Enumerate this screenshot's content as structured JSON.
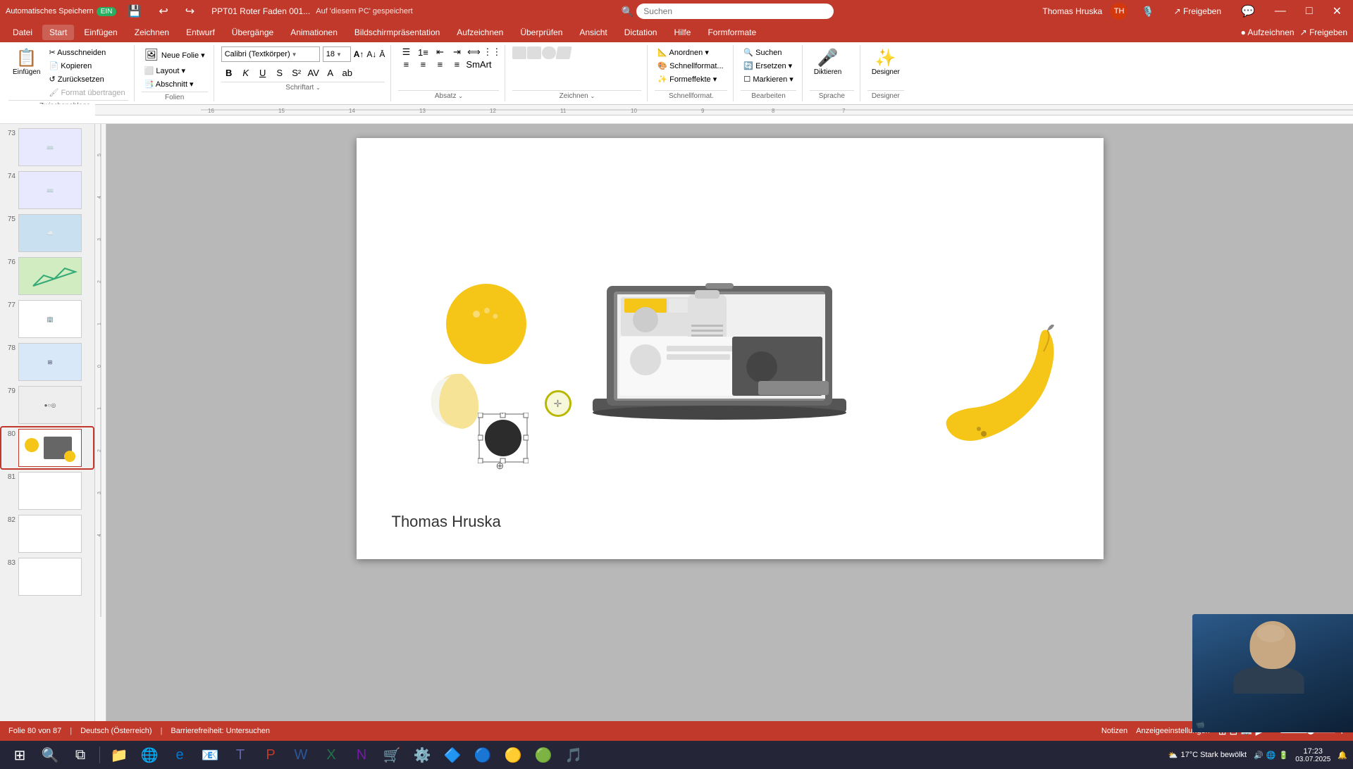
{
  "titlebar": {
    "autosave_label": "Automatisches Speichern",
    "toggle_state": "ON",
    "filename": "PPT01 Roter Faden 001...",
    "save_location": "Auf 'diesem PC' gespeichert",
    "search_placeholder": "Suchen",
    "user_name": "Thomas Hruska",
    "user_initials": "TH",
    "window_controls": {
      "minimize": "—",
      "maximize": "□",
      "close": "✕"
    }
  },
  "menubar": {
    "items": [
      "Datei",
      "Start",
      "Einfügen",
      "Zeichnen",
      "Entwurf",
      "Übergänge",
      "Animationen",
      "Bildschirmpräsentation",
      "Aufzeichnen",
      "Überprüfen",
      "Ansicht",
      "Dictation",
      "Hilfe",
      "Formformate"
    ]
  },
  "ribbon": {
    "active_tab": "Start",
    "groups": [
      {
        "label": "Zwischenablage",
        "buttons": [
          "Einfügen",
          "Ausschneiden",
          "Kopieren",
          "Zurücksetzen",
          "Format übertragen"
        ]
      },
      {
        "label": "Folien",
        "buttons": [
          "Neue Folie",
          "Layout",
          "Abschnitt"
        ]
      },
      {
        "label": "Schriftart",
        "font_name": "Calibri (Textkörper)",
        "font_size": "18",
        "buttons": [
          "F",
          "K",
          "U",
          "S",
          "ab",
          "A"
        ]
      },
      {
        "label": "Absatz",
        "buttons": [
          "Liste",
          "Numm. Liste",
          "Links",
          "Mitte",
          "Rechts"
        ]
      },
      {
        "label": "Zeichnen",
        "buttons": []
      },
      {
        "label": "Bearbeiten",
        "buttons": [
          "Suchen",
          "Ersetzen",
          "Markieren"
        ]
      },
      {
        "label": "Sprache",
        "buttons": [
          "Diktieren"
        ]
      },
      {
        "label": "Designer",
        "buttons": [
          "Designer"
        ]
      }
    ]
  },
  "slides": {
    "total": 87,
    "current": 80,
    "visible": [
      {
        "num": 73,
        "content": "keyboard"
      },
      {
        "num": 74,
        "content": "keyboard2"
      },
      {
        "num": 75,
        "content": "clouds"
      },
      {
        "num": 76,
        "content": "chart"
      },
      {
        "num": 77,
        "content": "office"
      },
      {
        "num": 78,
        "content": "grid"
      },
      {
        "num": 79,
        "content": "objects"
      },
      {
        "num": 80,
        "content": "laptop_scene",
        "active": true
      },
      {
        "num": 81,
        "content": "blank"
      },
      {
        "num": 82,
        "content": "blank"
      },
      {
        "num": 83,
        "content": "blank"
      }
    ]
  },
  "slide_content": {
    "author": "Thomas Hruska",
    "objects": [
      "yellow_circle",
      "crescent",
      "laptop",
      "banana",
      "dark_circle"
    ]
  },
  "statusbar": {
    "slide_info": "Folie 80 von 87",
    "accessibility": "Barrierefreiheit: Untersuchen",
    "language": "Deutsch (Österreich)",
    "notes": "Notizen",
    "display_settings": "Anzeigeeinstellungen"
  },
  "taskbar": {
    "start_icon": "⊞",
    "weather": "17°C  Stark bewölkt",
    "time": "17:23",
    "date": "03.07.2025",
    "apps": [
      "🪟",
      "📁",
      "🌐",
      "🔴",
      "📊",
      "📧",
      "💬",
      "🔵",
      "📗",
      "🎵",
      "⚙️",
      "🔶",
      "📘",
      "💻",
      "🧩",
      "🎯",
      "🟣",
      "🟢",
      "🟡",
      "💼"
    ]
  },
  "icons": {
    "search": "🔍",
    "save": "💾",
    "undo": "↩",
    "redo": "↪",
    "bold": "B",
    "italic": "I",
    "underline": "U",
    "microphone": "🎤",
    "designer": "✨"
  }
}
